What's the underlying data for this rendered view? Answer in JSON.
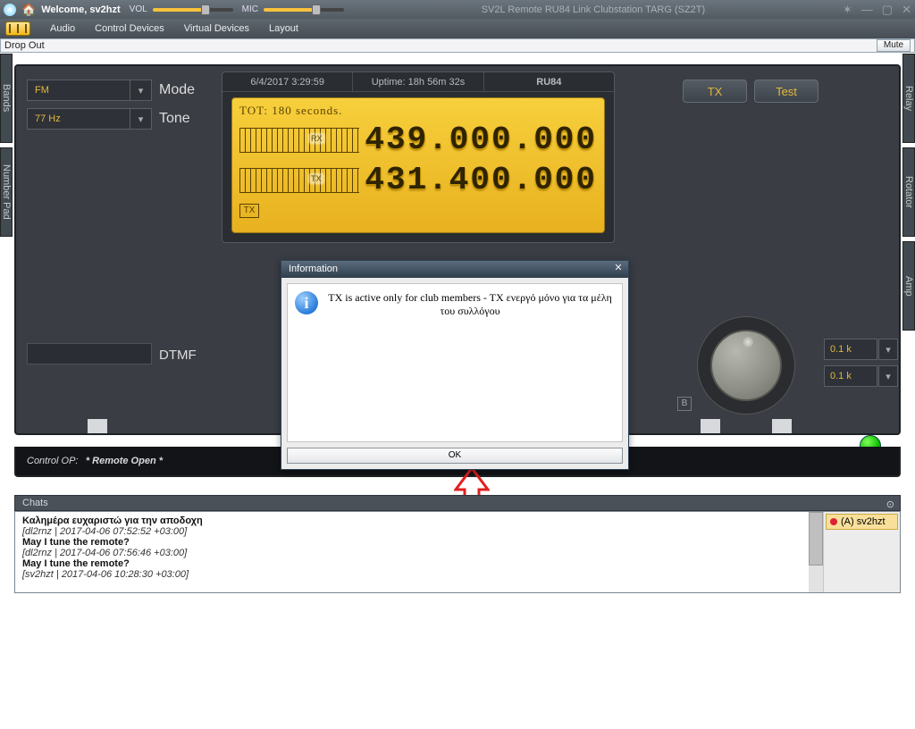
{
  "titlebar": {
    "welcome": "Welcome,",
    "user": "sv2hzt",
    "vol": "VOL",
    "mic": "MIC",
    "center": "SV2L Remote RU84 Link Clubstation TARG (SZ2T)"
  },
  "menu": {
    "audio": "Audio",
    "control": "Control Devices",
    "virtual": "Virtual Devices",
    "layout": "Layout"
  },
  "dropbar": {
    "label": "Drop Out",
    "mute": "Mute"
  },
  "side": {
    "bands": "Bands",
    "numpad": "Number Pad",
    "relay": "Relay",
    "rotator": "Rotator",
    "amp": "Amp"
  },
  "controls": {
    "mode_label": "Mode",
    "mode_value": "FM",
    "tone_label": "Tone",
    "tone_value": "77 Hz",
    "dtmf": "DTMF",
    "tx": "TX",
    "test": "Test",
    "step1": "0.1 k",
    "step2": "0.1 k",
    "b": "B"
  },
  "lcd": {
    "datetime": "6/4/2017 3:29:59",
    "uptime": "Uptime: 18h 56m 32s",
    "profile": "RU84",
    "tot": "TOT: 180 seconds.",
    "rx": "RX",
    "tx": "TX",
    "freq_rx": "439.000.000",
    "freq_tx": "431.400.000",
    "tx_badge": "TX"
  },
  "ctrlop": {
    "label": "Control OP:",
    "value": "* Remote Open *"
  },
  "chats": {
    "title": "Chats",
    "user_badge": "(A) sv2hzt",
    "lines": [
      {
        "b": "Καλημέρα ευχαριστώ για την αποδοχη"
      },
      {
        "i": "[dl2rnz | 2017-04-06 07:52:52 +03:00]"
      },
      {
        "b": "May I tune the remote?"
      },
      {
        "i": "[dl2rnz | 2017-04-06 07:56:46 +03:00]"
      },
      {
        "b": "May I tune the remote?"
      },
      {
        "i": "[sv2hzt | 2017-04-06 10:28:30 +03:00]"
      }
    ]
  },
  "dialog": {
    "title": "Information",
    "text": "TX is active only for club members - TX ενεργό μόνο για τα μέλη του συλλόγου",
    "ok": "OK"
  }
}
